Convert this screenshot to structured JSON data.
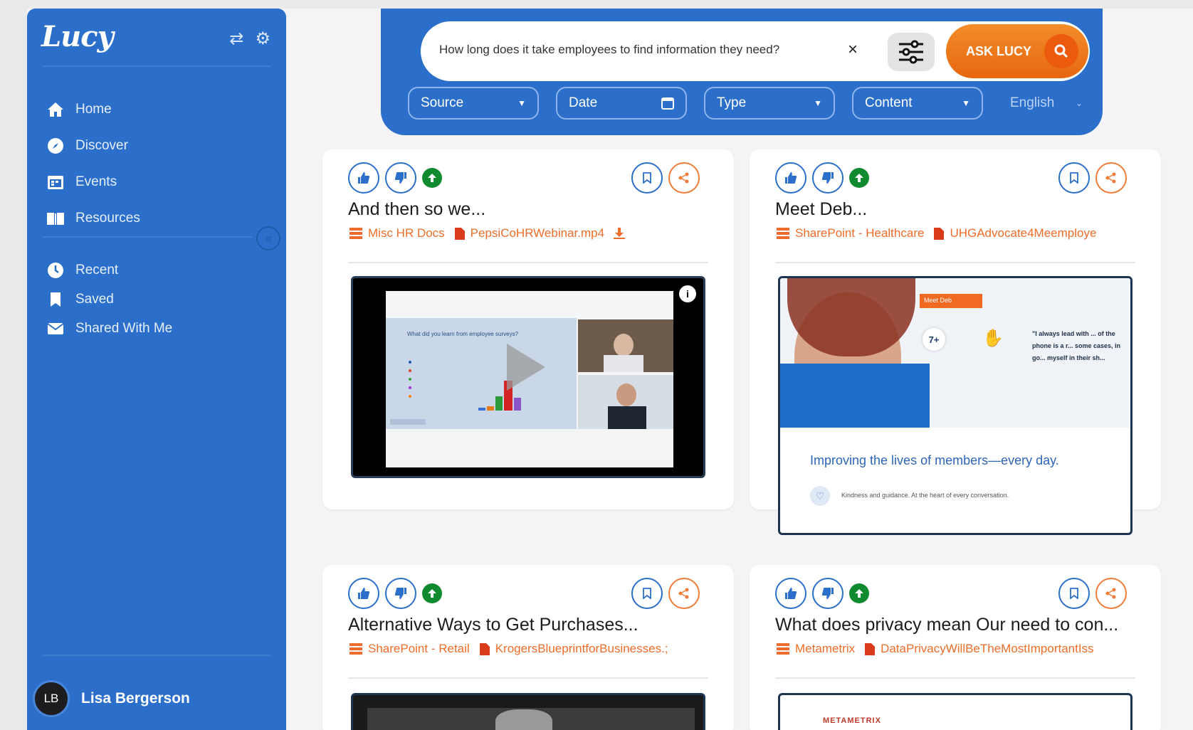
{
  "app": {
    "logo": "Lucy"
  },
  "sidebar": {
    "nav_primary": [
      {
        "label": "Home",
        "icon": "home-icon"
      },
      {
        "label": "Discover",
        "icon": "compass-icon"
      },
      {
        "label": "Events",
        "icon": "calendar-icon"
      },
      {
        "label": "Resources",
        "icon": "book-icon"
      }
    ],
    "nav_secondary": [
      {
        "label": "Recent",
        "icon": "clock-icon"
      },
      {
        "label": "Saved",
        "icon": "bookmark-icon"
      },
      {
        "label": "Shared With Me",
        "icon": "envelope-icon"
      }
    ],
    "user": {
      "initials": "LB",
      "name": "Lisa Bergerson"
    }
  },
  "search": {
    "query": "How long does it take employees to find information they need?",
    "ask_label": "ASK LUCY",
    "filters": [
      {
        "label": "Source",
        "kind": "dropdown"
      },
      {
        "label": "Date",
        "kind": "date"
      },
      {
        "label": "Type",
        "kind": "dropdown"
      },
      {
        "label": "Content",
        "kind": "dropdown"
      }
    ],
    "language": "English"
  },
  "results": [
    {
      "title": "And then so we...",
      "source": "Misc HR Docs",
      "file": "PepsiCoHRWebinar.mp4",
      "thumb_caption": "What did you learn from employee surveys?"
    },
    {
      "title": "Meet Deb...",
      "source": "SharePoint - Healthcare",
      "file": "UHGAdvocate4Meemploye",
      "thumb_badge": "Meet Deb",
      "thumb_stat": "7+",
      "thumb_tagline": "Improving the lives of members—every day.",
      "thumb_quote": "\"I always lead with ... of the phone is a r... some cases, in go... myself in their sh...",
      "thumb_footer": "Kindness and guidance. At the heart of every conversation."
    },
    {
      "title": "Alternative Ways to Get Purchases...",
      "source": "SharePoint - Retail",
      "file": "KrogersBlueprintforBusinesses.;"
    },
    {
      "title": "What does privacy mean Our need to con...",
      "source": "Metametrix",
      "file": "DataPrivacyWillBeTheMostImportantIss",
      "thumb_logo": "METAMETRIX"
    }
  ],
  "colors": {
    "brand_blue": "#2b6fcb",
    "accent_orange": "#ee6d2a",
    "upvote_green": "#0f8a2f"
  }
}
